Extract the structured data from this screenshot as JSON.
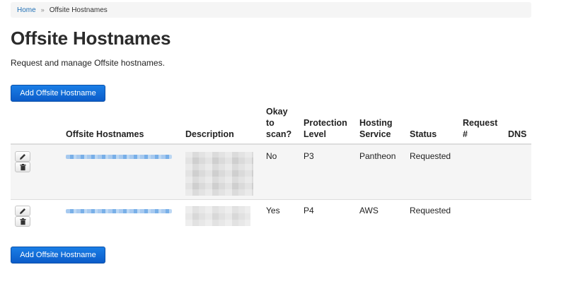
{
  "breadcrumb": {
    "home": "Home",
    "separator": "»",
    "current": "Offsite Hostnames"
  },
  "page": {
    "title": "Offsite Hostnames",
    "subtitle": "Request and manage Offsite hostnames."
  },
  "actions": {
    "add_label": "Add Offsite Hostname"
  },
  "table": {
    "headers": {
      "hostnames": "Offsite Hostnames",
      "description": "Description",
      "okay_line1": "Okay",
      "okay_line2": "to",
      "okay_line3": "scan?",
      "protection_line1": "Protection",
      "protection_line2": "Level",
      "hosting_line1": "Hosting",
      "hosting_line2": "Service",
      "status": "Status",
      "request_line1": "Request",
      "request_line2": "#",
      "dns": "DNS"
    },
    "rows": [
      {
        "okay_to_scan": "No",
        "protection_level": "P3",
        "hosting_service": "Pantheon",
        "status": "Requested",
        "request_number": "",
        "dns": ""
      },
      {
        "okay_to_scan": "Yes",
        "protection_level": "P4",
        "hosting_service": "AWS",
        "status": "Requested",
        "request_number": "",
        "dns": ""
      }
    ]
  },
  "icons": {
    "edit": "pencil-icon",
    "delete": "trash-icon"
  },
  "colors": {
    "primary_button": "#0b6ad6",
    "link": "#1f6fb5",
    "row_stripe": "#f5f5f5"
  }
}
